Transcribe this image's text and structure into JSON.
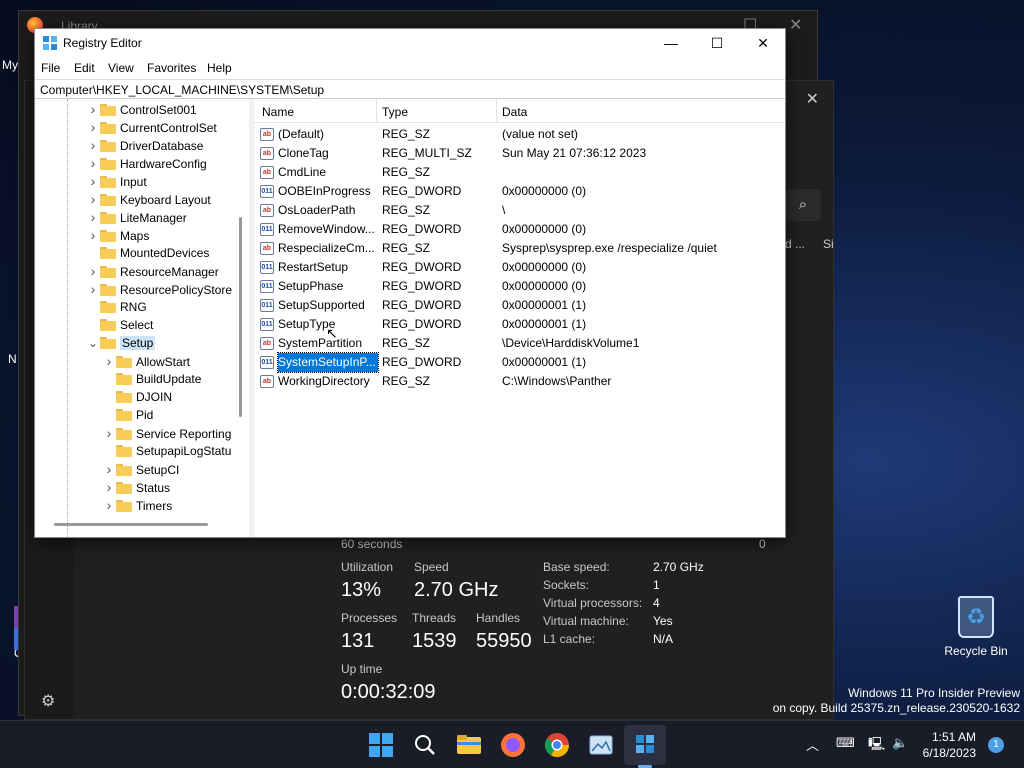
{
  "desktop": {
    "recycle_bin_label": "Recycle Bin",
    "watermark_line1": "Windows 11 Pro Insider Preview",
    "watermark_line2": "on copy. Build 25375.zn_release.230520-1632",
    "left_labels": [
      "My",
      "N",
      "O"
    ]
  },
  "background_window": {
    "title": "Library"
  },
  "task_manager": {
    "edge_text_1": "d ...",
    "edge_text_2": "Si",
    "duration_label": "60 seconds",
    "duration_end": "0",
    "utilization_label": "Utilization",
    "utilization_value": "13%",
    "speed_label": "Speed",
    "speed_value": "2.70 GHz",
    "processes_label": "Processes",
    "processes_value": "131",
    "threads_label": "Threads",
    "threads_value": "1539",
    "handles_label": "Handles",
    "handles_value": "55950",
    "uptime_label": "Up time",
    "uptime_value": "0:00:32:09",
    "details": [
      {
        "label": "Base speed:",
        "value": "2.70 GHz"
      },
      {
        "label": "Sockets:",
        "value": "1"
      },
      {
        "label": "Virtual processors:",
        "value": "4"
      },
      {
        "label": "Virtual machine:",
        "value": "Yes"
      },
      {
        "label": "L1 cache:",
        "value": "N/A"
      }
    ]
  },
  "regedit": {
    "title": "Registry Editor",
    "menu": [
      "File",
      "Edit",
      "View",
      "Favorites",
      "Help"
    ],
    "address": "Computer\\HKEY_LOCAL_MACHINE\\SYSTEM\\Setup",
    "tree": [
      {
        "label": "ControlSet001",
        "level": 1,
        "expander": ">"
      },
      {
        "label": "CurrentControlSet",
        "level": 1,
        "expander": ">"
      },
      {
        "label": "DriverDatabase",
        "level": 1,
        "expander": ">"
      },
      {
        "label": "HardwareConfig",
        "level": 1,
        "expander": ">"
      },
      {
        "label": "Input",
        "level": 1,
        "expander": ">"
      },
      {
        "label": "Keyboard Layout",
        "level": 1,
        "expander": ">"
      },
      {
        "label": "LiteManager",
        "level": 1,
        "expander": ">"
      },
      {
        "label": "Maps",
        "level": 1,
        "expander": ">"
      },
      {
        "label": "MountedDevices",
        "level": 1,
        "expander": ""
      },
      {
        "label": "ResourceManager",
        "level": 1,
        "expander": ">"
      },
      {
        "label": "ResourcePolicyStore",
        "level": 1,
        "expander": ">"
      },
      {
        "label": "RNG",
        "level": 1,
        "expander": ""
      },
      {
        "label": "Select",
        "level": 1,
        "expander": ""
      },
      {
        "label": "Setup",
        "level": 1,
        "expander": "v",
        "selected": true
      },
      {
        "label": "AllowStart",
        "level": 2,
        "expander": ">"
      },
      {
        "label": "BuildUpdate",
        "level": 2,
        "expander": ""
      },
      {
        "label": "DJOIN",
        "level": 2,
        "expander": ""
      },
      {
        "label": "Pid",
        "level": 2,
        "expander": ""
      },
      {
        "label": "Service Reporting",
        "level": 2,
        "expander": ">"
      },
      {
        "label": "SetupapiLogStatu",
        "level": 2,
        "expander": ""
      },
      {
        "label": "SetupCI",
        "level": 2,
        "expander": ">"
      },
      {
        "label": "Status",
        "level": 2,
        "expander": ">"
      },
      {
        "label": "Timers",
        "level": 2,
        "expander": ">"
      }
    ],
    "columns": {
      "name": "Name",
      "type": "Type",
      "data": "Data"
    },
    "values": [
      {
        "name": "(Default)",
        "type": "REG_SZ",
        "data": "(value not set)",
        "icon": "sz"
      },
      {
        "name": "CloneTag",
        "type": "REG_MULTI_SZ",
        "data": "Sun May 21 07:36:12 2023",
        "icon": "sz"
      },
      {
        "name": "CmdLine",
        "type": "REG_SZ",
        "data": "",
        "icon": "sz"
      },
      {
        "name": "OOBEInProgress",
        "type": "REG_DWORD",
        "data": "0x00000000 (0)",
        "icon": "dw"
      },
      {
        "name": "OsLoaderPath",
        "type": "REG_SZ",
        "data": "\\",
        "icon": "sz"
      },
      {
        "name": "RemoveWindow...",
        "type": "REG_DWORD",
        "data": "0x00000000 (0)",
        "icon": "dw"
      },
      {
        "name": "RespecializeCm...",
        "type": "REG_SZ",
        "data": "Sysprep\\sysprep.exe /respecialize /quiet",
        "icon": "sz"
      },
      {
        "name": "RestartSetup",
        "type": "REG_DWORD",
        "data": "0x00000000 (0)",
        "icon": "dw"
      },
      {
        "name": "SetupPhase",
        "type": "REG_DWORD",
        "data": "0x00000000 (0)",
        "icon": "dw"
      },
      {
        "name": "SetupSupported",
        "type": "REG_DWORD",
        "data": "0x00000001 (1)",
        "icon": "dw"
      },
      {
        "name": "SetupType",
        "type": "REG_DWORD",
        "data": "0x00000001 (1)",
        "icon": "dw"
      },
      {
        "name": "SystemPartition",
        "type": "REG_SZ",
        "data": "\\Device\\HarddiskVolume1",
        "icon": "sz"
      },
      {
        "name": "SystemSetupInP...",
        "type": "REG_DWORD",
        "data": "0x00000001 (1)",
        "icon": "dw",
        "selected": true
      },
      {
        "name": "WorkingDirectory",
        "type": "REG_SZ",
        "data": "C:\\Windows\\Panther",
        "icon": "sz"
      }
    ]
  },
  "taskbar": {
    "time": "1:51 AM",
    "date": "6/18/2023",
    "notification_count": "1",
    "colors": {
      "accent": "#0078d7",
      "folder": "#f7cd57"
    }
  }
}
